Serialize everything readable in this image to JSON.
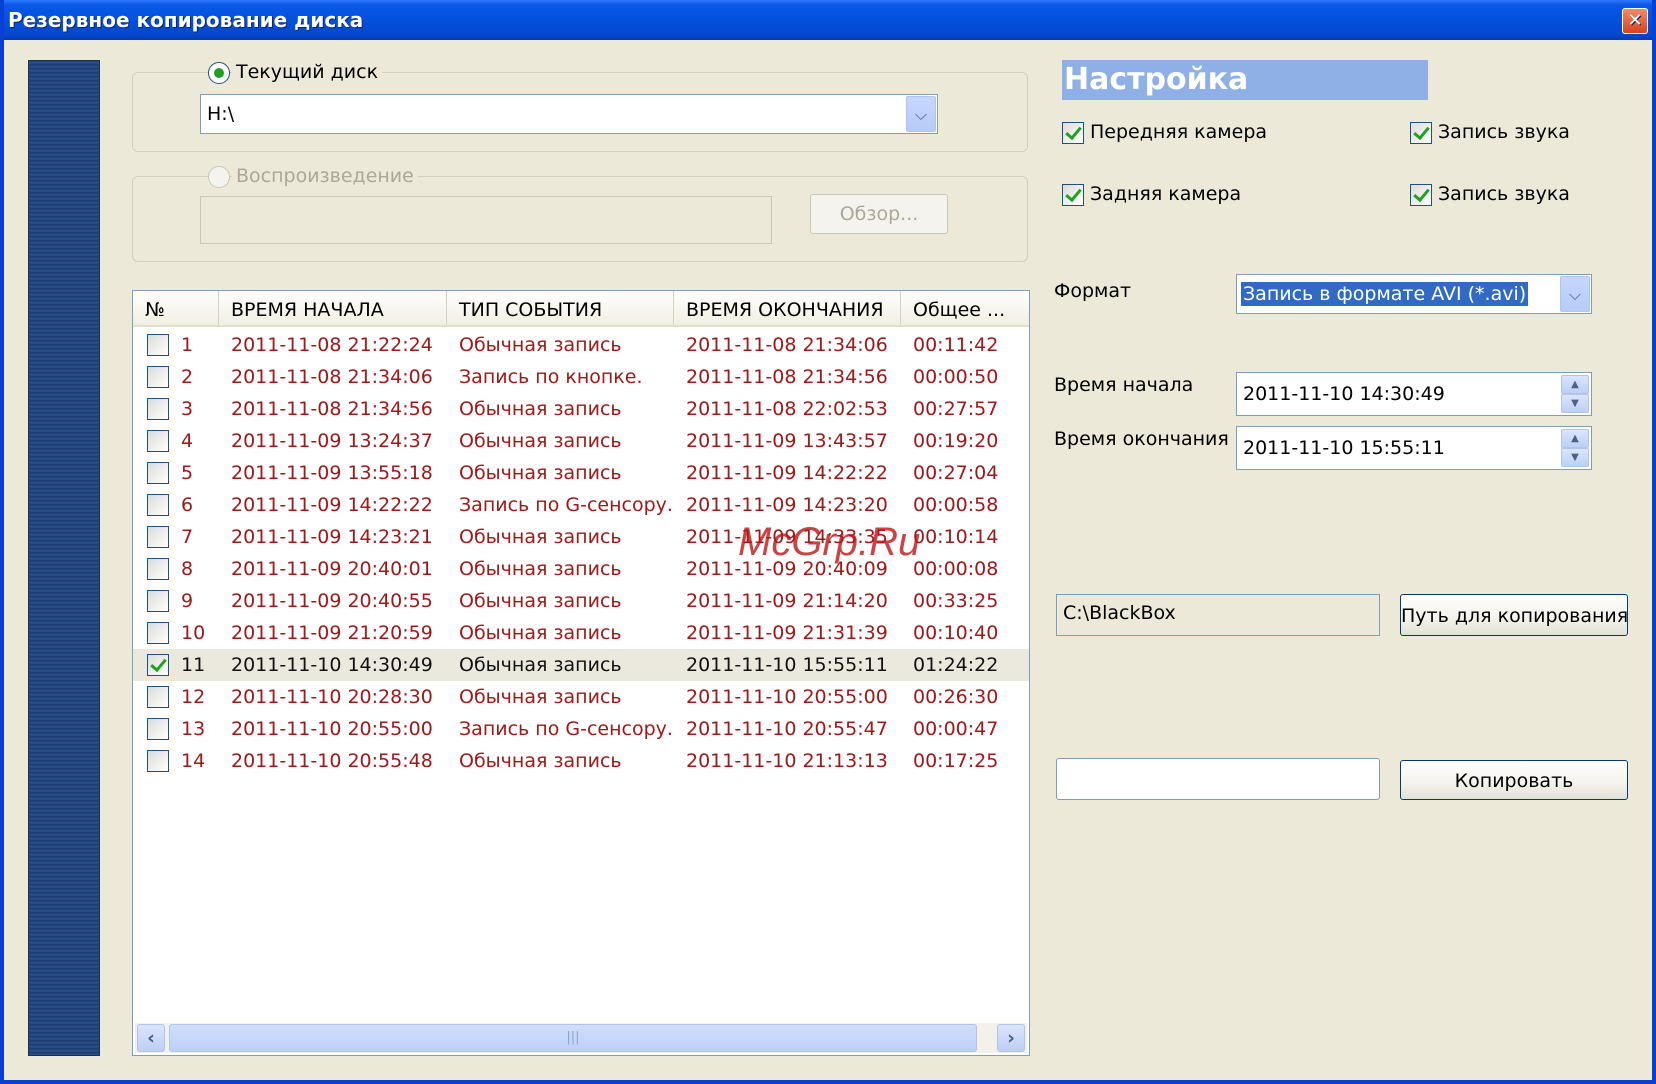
{
  "window": {
    "title": "Резервное копирование диска",
    "close_glyph": "✕"
  },
  "source": {
    "current_disk_label": "Текущий диск",
    "current_disk_value": "H:\\",
    "playback_label": "Воспроизведение",
    "playback_path": "",
    "browse_label": "Обзор..."
  },
  "list": {
    "columns": [
      "№",
      "ВРЕМЯ НАЧАЛА",
      "ТИП СОБЫТИЯ",
      "ВРЕМЯ ОКОНЧАНИЯ",
      "Общее ..."
    ],
    "rows": [
      {
        "n": "1",
        "start": "2011-11-08 21:22:24",
        "type": "Обычная запись",
        "end": "2011-11-08 21:34:06",
        "total": "00:11:42",
        "checked": false
      },
      {
        "n": "2",
        "start": "2011-11-08 21:34:06",
        "type": "Запись по кнопке.",
        "end": "2011-11-08 21:34:56",
        "total": "00:00:50",
        "checked": false
      },
      {
        "n": "3",
        "start": "2011-11-08 21:34:56",
        "type": "Обычная запись",
        "end": "2011-11-08 22:02:53",
        "total": "00:27:57",
        "checked": false
      },
      {
        "n": "4",
        "start": "2011-11-09 13:24:37",
        "type": "Обычная запись",
        "end": "2011-11-09 13:43:57",
        "total": "00:19:20",
        "checked": false
      },
      {
        "n": "5",
        "start": "2011-11-09 13:55:18",
        "type": "Обычная запись",
        "end": "2011-11-09 14:22:22",
        "total": "00:27:04",
        "checked": false
      },
      {
        "n": "6",
        "start": "2011-11-09 14:22:22",
        "type": "Запись по G-сенсору.",
        "end": "2011-11-09 14:23:20",
        "total": "00:00:58",
        "checked": false
      },
      {
        "n": "7",
        "start": "2011-11-09 14:23:21",
        "type": "Обычная запись",
        "end": "2011-11-09 14:33:35",
        "total": "00:10:14",
        "checked": false
      },
      {
        "n": "8",
        "start": "2011-11-09 20:40:01",
        "type": "Обычная запись",
        "end": "2011-11-09 20:40:09",
        "total": "00:00:08",
        "checked": false
      },
      {
        "n": "9",
        "start": "2011-11-09 20:40:55",
        "type": "Обычная запись",
        "end": "2011-11-09 21:14:20",
        "total": "00:33:25",
        "checked": false
      },
      {
        "n": "10",
        "start": "2011-11-09 21:20:59",
        "type": "Обычная запись",
        "end": "2011-11-09 21:31:39",
        "total": "00:10:40",
        "checked": false
      },
      {
        "n": "11",
        "start": "2011-11-10 14:30:49",
        "type": "Обычная запись",
        "end": "2011-11-10 15:55:11",
        "total": "01:24:22",
        "checked": true
      },
      {
        "n": "12",
        "start": "2011-11-10 20:28:30",
        "type": "Обычная запись",
        "end": "2011-11-10 20:55:00",
        "total": "00:26:30",
        "checked": false
      },
      {
        "n": "13",
        "start": "2011-11-10 20:55:00",
        "type": "Запись по G-сенсору.",
        "end": "2011-11-10 20:55:47",
        "total": "00:00:47",
        "checked": false
      },
      {
        "n": "14",
        "start": "2011-11-10 20:55:48",
        "type": "Обычная запись",
        "end": "2011-11-10 21:13:13",
        "total": "00:17:25",
        "checked": false
      }
    ],
    "scroll_grip": "|||"
  },
  "settings": {
    "title": "Настройка",
    "front_camera": "Передняя камера",
    "rear_camera": "Задняя камера",
    "audio_1": "Запись звука",
    "audio_2": "Запись звука",
    "format_label": "Формат",
    "format_value": "Запись в формате AVI (*.avi)",
    "start_label": "Время начала",
    "start_value": "2011-11-10 14:30:49",
    "end_label": "Время окончания",
    "end_value": "2011-11-10 15:55:11",
    "path_value": "C:\\BlackBox",
    "path_button": "Путь для копирования",
    "progress_value": "",
    "copy_button": "Копировать"
  },
  "icons": {
    "dropdown": "chevron-down-icon",
    "spin_up": "spin-up-icon",
    "spin_down": "spin-down-icon",
    "scroll_left": "arrow-left-icon",
    "scroll_right": "arrow-right-icon",
    "check": "checkmark-icon"
  },
  "colors": {
    "titlebar": "#0550dd",
    "window_bg": "#ece9d8",
    "row_text": "#a01818",
    "check_green": "#21a121",
    "settings_header": "#8fb0e6"
  },
  "watermark": "McGrp.Ru"
}
